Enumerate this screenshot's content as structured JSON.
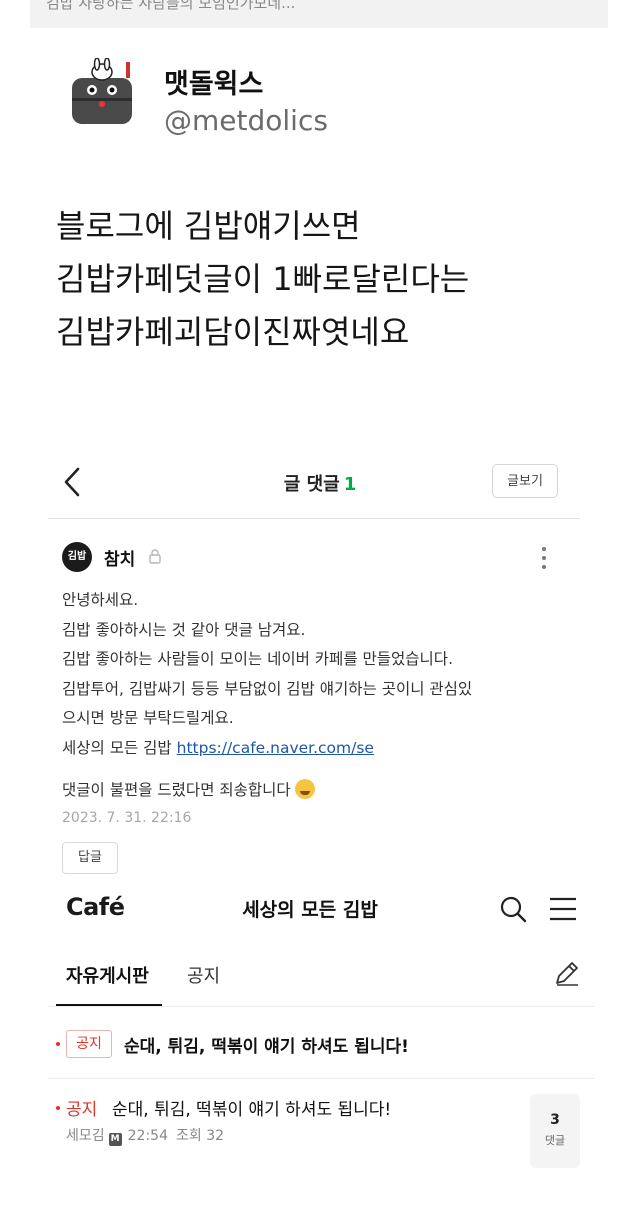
{
  "top_caption": "김밥 사랑하는 사람들의 모임인가보네...",
  "tweet": {
    "display_name": "맷돌윅스",
    "handle": "@metdolics",
    "lines": [
      "블로그에 김밥얘기쓰면",
      "김밥카페덧글이 1빠로달린다는",
      "김밥카페괴담이진짜엿네요"
    ]
  },
  "comments_screen": {
    "title": "글 댓글",
    "count": "1",
    "view_post_label": "글보기",
    "comment": {
      "avatar_text": "김밥",
      "author": "참치",
      "lines": [
        "안녕하세요.",
        "김밥 좋아하시는 것 같아 댓글 남겨요.",
        "김밥 좋아하는 사람들이 모이는 네이버 카페를 만들었습니다.",
        "김밥투어, 김밥싸기 등등 부담없이 김밥 얘기하는 곳이니 관심있",
        "으시면 방문 부탁드릴게요."
      ],
      "link_prefix": "세상의 모든 김밥",
      "link_text": "https://cafe.naver.com/se",
      "sorry_text": "댓글이 불편을 드렸다면 죄송합니다",
      "date": "2023. 7. 31. 22:16",
      "reply_label": "답글"
    }
  },
  "cafe": {
    "logo": "Café",
    "title": "세상의 모든 김밥",
    "tabs": [
      "자유게시판",
      "공지"
    ],
    "notice_pinned": {
      "tag": "공지",
      "title": "순대, 튀김, 떡볶이 얘기 하셔도 됩니다!"
    },
    "notice_post": {
      "tag": "공지",
      "title": "순대, 튀김, 떡볶이 얘기 하셔도 됩니다!",
      "author": "세모김",
      "author_badge": "M",
      "time": "22:54",
      "views": "조회 32",
      "comment_count": "3",
      "comment_label": "댓글"
    }
  },
  "colors": {
    "accent_green": "#03a94d",
    "notice_red": "#e1322c",
    "link_blue": "#1f57a8"
  }
}
